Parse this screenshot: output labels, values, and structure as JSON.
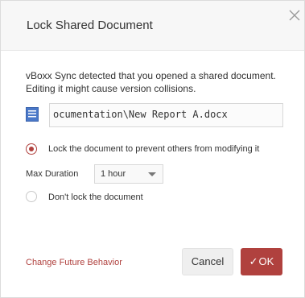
{
  "dialog": {
    "title": "Lock Shared Document",
    "close_icon": "close-icon",
    "message": "vBoxx Sync detected that you opened a shared document. Editing it might cause version collisions.",
    "document_icon": "document-icon",
    "document_path": "ocumentation\\New Report A.docx",
    "options": {
      "lock_label": "Lock the document to prevent others from modifying it",
      "lock_selected": true,
      "max_duration_label": "Max Duration",
      "duration_value": "1 hour",
      "dont_lock_label": "Don't lock the document",
      "dont_lock_selected": false
    },
    "change_link": "Change Future Behavior",
    "cancel_label": "Cancel",
    "ok_check": "✓",
    "ok_label": "OK"
  },
  "colors": {
    "accent": "#b0413e",
    "header_bg": "#f7f7f7",
    "border": "#d8d8d8"
  }
}
